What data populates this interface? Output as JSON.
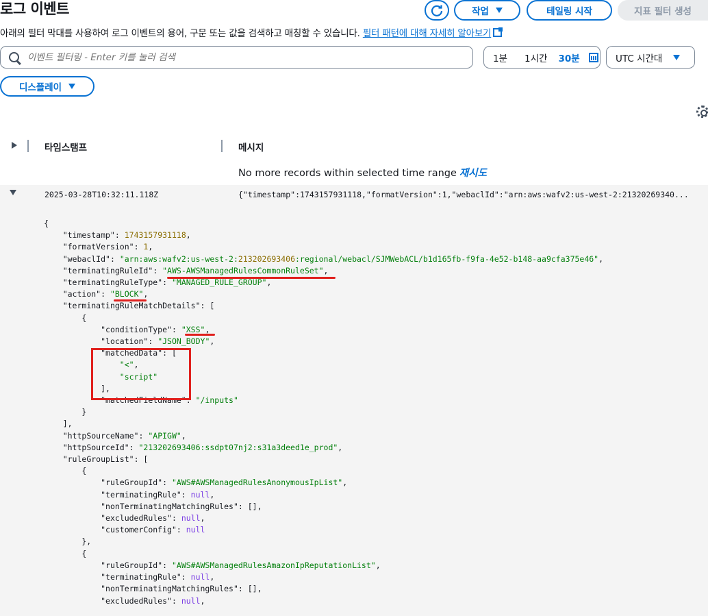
{
  "header": {
    "title": "로그 이벤트",
    "action_label": "작업",
    "tail_label": "테일링 시작",
    "metric_filter_label": "지표 필터 생성",
    "description": "아래의 필터 막대를 사용하여 로그 이벤트의 용어, 구문 또는 값을 검색하고 매칭할 수 있습니다.",
    "learn_more_link": "필터 패턴에 대해 자세히 알아보기"
  },
  "search": {
    "placeholder": "이벤트 필터링 - Enter 키를 눌러 검색"
  },
  "time_range": {
    "option_1": "1분",
    "option_2": "1시간",
    "option_3": "30분",
    "selected": "30분"
  },
  "timezone": {
    "label": "UTC 시간대"
  },
  "display": {
    "label": "디스플레이"
  },
  "table": {
    "col_timestamp": "타임스탬프",
    "col_message": "메시지",
    "no_more_text": "No more records within selected time range",
    "retry_link": "재시도",
    "rows": [
      {
        "timestamp": "2025-03-28T10:32:11.118Z",
        "message": "{\"timestamp\":1743157931118,\"formatVersion\":1,\"webaclId\":\"arn:aws:wafv2:us-west-2:21320269340..."
      }
    ]
  },
  "json_lines": [
    "{",
    "    \"timestamp\": 1743157931118,",
    "    \"formatVersion\": 1,",
    "    \"webaclId\": \"arn:aws:wafv2:us-west-2:213202693406:regional/webacl/SJMWebACL/b1d165fb-f9fa-4e52-b148-aa9cfa375e46\",",
    "    \"terminatingRuleId\": \"AWS-AWSManagedRulesCommonRuleSet\",",
    "    \"terminatingRuleType\": \"MANAGED_RULE_GROUP\",",
    "    \"action\": \"BLOCK\",",
    "    \"terminatingRuleMatchDetails\": [",
    "        {",
    "            \"conditionType\": \"XSS\",",
    "            \"location\": \"JSON_BODY\",",
    "            \"matchedData\": [",
    "                \"<\",",
    "                \"script\"",
    "            ],",
    "            \"matchedFieldName\": \"/inputs\"",
    "        }",
    "    ],",
    "    \"httpSourceName\": \"APIGW\",",
    "    \"httpSourceId\": \"213202693406:ssdpt07nj2:s31a3deed1e_prod\",",
    "    \"ruleGroupList\": [",
    "        {",
    "            \"ruleGroupId\": \"AWS#AWSManagedRulesAnonymousIpList\",",
    "            \"terminatingRule\": null,",
    "            \"nonTerminatingMatchingRules\": [],",
    "            \"excludedRules\": null,",
    "            \"customerConfig\": null",
    "        },",
    "        {",
    "            \"ruleGroupId\": \"AWS#AWSManagedRulesAmazonIpReputationList\",",
    "            \"terminatingRule\": null,",
    "            \"nonTerminatingMatchingRules\": [],",
    "            \"excludedRules\": null,"
  ],
  "colors": {
    "accent": "#0972d3",
    "annotation": "#e0201d",
    "string": "#037f0c",
    "number": "#8a6d00",
    "null": "#7b3fe4"
  }
}
